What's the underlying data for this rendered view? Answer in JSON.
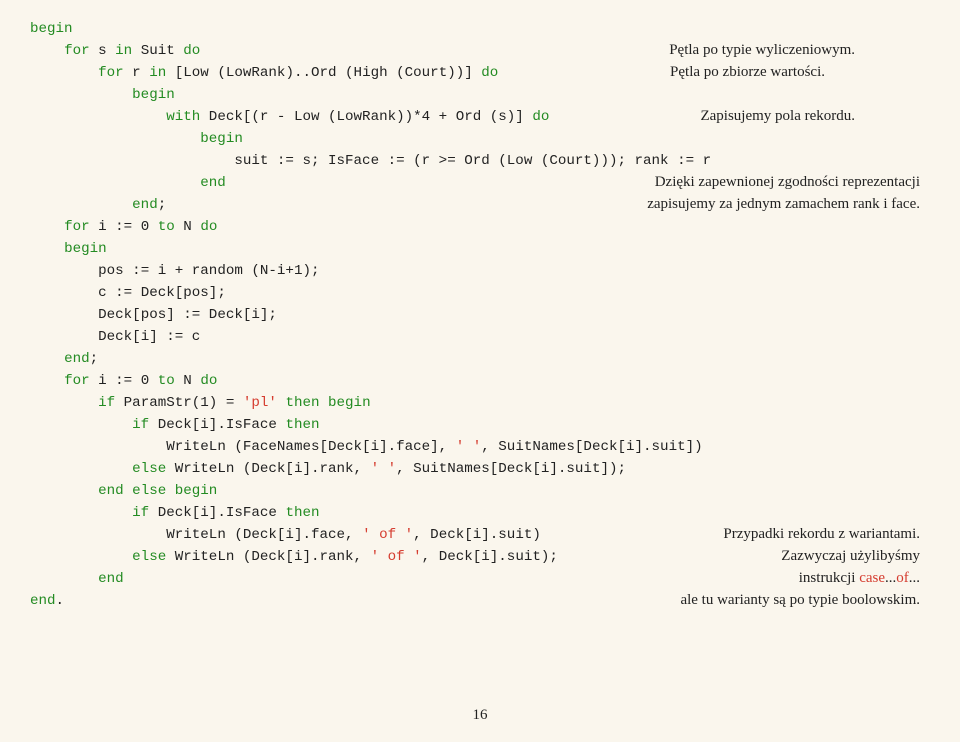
{
  "code": {
    "l1_begin": "begin",
    "l2_for": "for",
    "l2_s": " s ",
    "l2_in": "in",
    "l2_suit": " Suit ",
    "l2_do": "do",
    "l3_for": "for",
    "l3_r": " r ",
    "l3_in": "in",
    "l3_range": " [Low (LowRank)..Ord (High (Court))] ",
    "l3_do": "do",
    "l4_begin": "begin",
    "l5_with": "with",
    "l5_expr": " Deck[(r - Low (LowRank))*4 + Ord (s)] ",
    "l5_do": "do",
    "l6_begin": "begin",
    "l7": "suit := s; IsFace := (r >= Ord (Low (Court))); rank := r",
    "l8_end": "end",
    "l9_end": "end",
    "l9_semi": ";",
    "l10_for": "for",
    "l10_rest": " i := 0 ",
    "l10_to": "to",
    "l10_n": " N ",
    "l10_do": "do",
    "l11_begin": "begin",
    "l12": "pos := i + random (N-i+1);",
    "l13": "c := Deck[pos];",
    "l14": "Deck[pos] := Deck[i];",
    "l15": "Deck[i] := c",
    "l16_end": "end",
    "l16_semi": ";",
    "l17_for": "for",
    "l17_rest": " i := 0 ",
    "l17_to": "to",
    "l17_n": " N ",
    "l17_do": "do",
    "l18_if": "if",
    "l18_cond": " ParamStr(1) = ",
    "l18_str": "'pl'",
    "l18_then": " then begin",
    "l19_if": "if",
    "l19_cond": " Deck[i].IsFace ",
    "l19_then": "then",
    "l20_write": "WriteLn (FaceNames[Deck[i].face], ",
    "l20_str": "' '",
    "l20_rest": ", SuitNames[Deck[i].suit])",
    "l21_else": "else",
    "l21_write": " WriteLn (Deck[i].rank, ",
    "l21_str": "' '",
    "l21_rest": ", SuitNames[Deck[i].suit]);",
    "l22_end": "end",
    "l22_else": " else begin",
    "l23_if": "if",
    "l23_cond": " Deck[i].IsFace ",
    "l23_then": "then",
    "l24_write": "WriteLn (Deck[i].face, ",
    "l24_str": "' of '",
    "l24_rest": ", Deck[i].suit)",
    "l25_else": "else",
    "l25_write": " WriteLn (Deck[i].rank, ",
    "l25_str": "' of '",
    "l25_rest": ", Deck[i].suit);",
    "l26_end": "end",
    "l27_end": "end",
    "l27_dot": "."
  },
  "annot": {
    "a1": "Pętla po typie wyliczeniowym.",
    "a2": "Pętla po zbiorze wartości.",
    "a3": "Zapisujemy pola rekordu.",
    "a4l1": "Dzięki zapewnionej zgodności reprezentacji",
    "a4l2": "zapisujemy za jednym zamachem rank i face.",
    "a5": "Przypadki rekordu z wariantami.",
    "a6": "Zazwyczaj użylibyśmy",
    "a7_p1": "instrukcji ",
    "a7_case": "case",
    "a7_p2": "...",
    "a7_of": "of",
    "a7_p3": "...",
    "a8": "ale tu warianty są po typie boolowskim."
  },
  "pagenum": "16"
}
